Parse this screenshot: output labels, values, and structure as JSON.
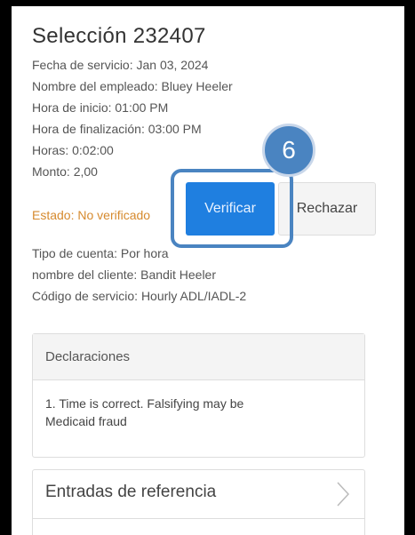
{
  "selection": {
    "title": "Selección 232407",
    "fecha": "Fecha de servicio: Jan 03, 2024",
    "empleado": "Nombre del empleado: Bluey Heeler",
    "inicio": "Hora de inicio: 01:00 PM",
    "finalizacion": "Hora de finalización: 03:00 PM",
    "horas": "Horas: 0:02:00",
    "monto": "Monto: 2,00",
    "estado": "Estado: No verificado",
    "tipo_cuenta": "Tipo de cuenta: Por hora",
    "cliente": "nombre del cliente: Bandit Heeler",
    "codigo": "Código de servicio: Hourly ADL/IADL-2"
  },
  "actions": {
    "verify_label": "Verificar",
    "reject_label": "Rechazar"
  },
  "callout": {
    "step_number": "6"
  },
  "declaraciones": {
    "header": "Declaraciones",
    "text": "1. Time is correct. Falsifying may be Medicaid fraud"
  },
  "references": {
    "label": "Entradas de referencia"
  },
  "colors": {
    "accent": "#1f7fe0",
    "callout": "#4a84c1",
    "status": "#d68a2e"
  },
  "icons": [
    "chevron-right-icon"
  ]
}
